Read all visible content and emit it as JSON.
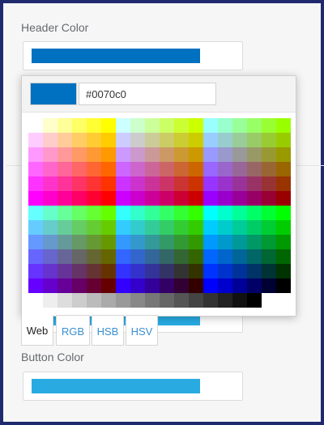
{
  "fields": {
    "header": {
      "label": "Header Color",
      "color": "#0070c0"
    },
    "background": {
      "color": "#29abe2"
    },
    "button": {
      "label": "Button Color",
      "color": "#29abe2"
    }
  },
  "picker": {
    "selected_hex": "#0070c0",
    "tabs": [
      "Web",
      "RGB",
      "HSB",
      "HSV"
    ],
    "active_tab": "Web"
  }
}
